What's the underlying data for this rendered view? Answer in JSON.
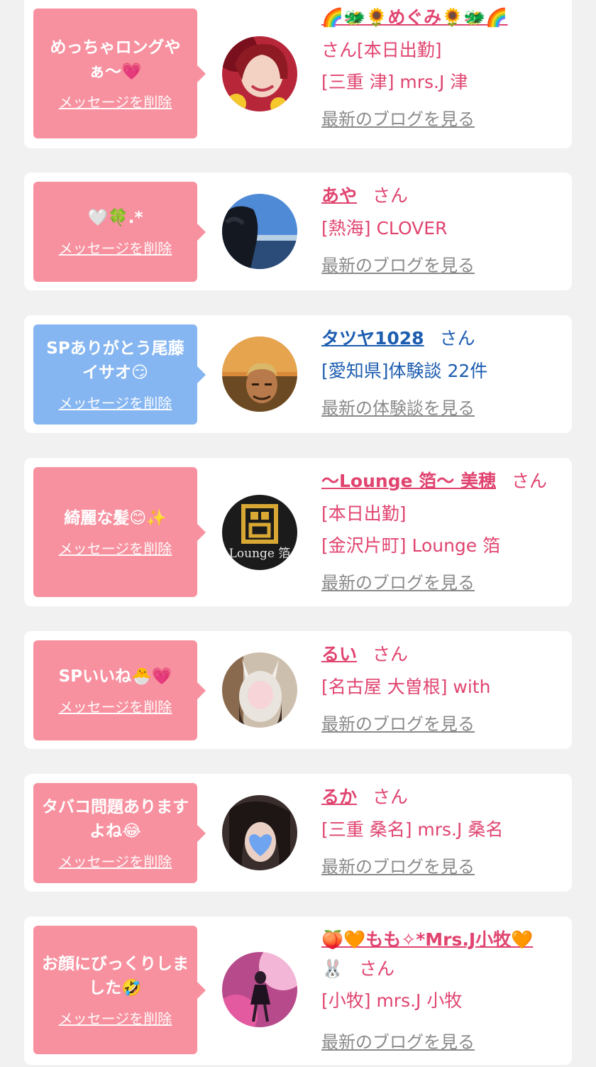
{
  "delete_label": "メッセージを削除",
  "colors": {
    "bubble_pink": "#f8919f",
    "bubble_blue": "#86b6f1",
    "name_pink": "#e0446f",
    "name_blue": "#1d5db0",
    "link_gray": "#8a8a8a"
  },
  "messages": [
    {
      "bubble_text": "めっちゃロングやぁ〜💗",
      "name": "🌈🐲🌻めぐみ🌻🐲🌈",
      "suffix": "さん",
      "status": "[本日出勤]",
      "location": "[三重 津] mrs.J 津",
      "more_link": "最新のブログを見る",
      "avatar_icon": "woman-selfie"
    },
    {
      "bubble_text": "🤍🍀.*",
      "name": "あや",
      "suffix": "さん",
      "location": "[熱海] CLOVER",
      "more_link": "最新のブログを見る",
      "avatar_icon": "seaside-photo"
    },
    {
      "bubble_text": "SPありがとう尾藤イサオ😏",
      "name": "タツヤ1028",
      "suffix": "さん",
      "location": "[愛知県]体験談 22件",
      "more_link": "最新の体験談を見る",
      "avatar_icon": "man-selfie"
    },
    {
      "bubble_text": "綺麗な髪😊✨",
      "name": "〜Lounge 箔〜 美穂",
      "suffix": "さん",
      "status": "[本日出勤]",
      "location": "[金沢片町] Lounge 箔",
      "more_link": "最新のブログを見る",
      "avatar_icon": "lounge-logo",
      "avatar_text": "Lounge 箔"
    },
    {
      "bubble_text": "SPいいね🐣💗",
      "name": "るい",
      "suffix": "さん",
      "location": "[名古屋 大曽根] with",
      "more_link": "最新のブログを見る",
      "avatar_icon": "bunny-ears-photo"
    },
    {
      "bubble_text": "タバコ問題ありますよね😂",
      "name": "るか",
      "suffix": "さん",
      "location": "[三重 桑名] mrs.J 桑名",
      "more_link": "最新のブログを見る",
      "avatar_icon": "heart-face-photo"
    },
    {
      "bubble_text": "お顔にびっくりしました🤣",
      "name": "🍑🧡もも✧*Mrs.J小牧🧡",
      "name_extra": "🐰",
      "suffix": "さん",
      "location": "[小牧] mrs.J 小牧",
      "more_link": "最新のブログを見る",
      "avatar_icon": "dancer-photo"
    }
  ]
}
